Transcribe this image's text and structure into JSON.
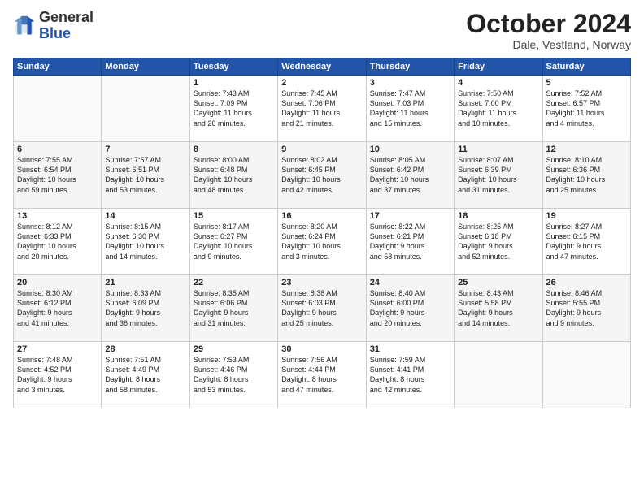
{
  "header": {
    "logo_general": "General",
    "logo_blue": "Blue",
    "month": "October 2024",
    "location": "Dale, Vestland, Norway"
  },
  "weekdays": [
    "Sunday",
    "Monday",
    "Tuesday",
    "Wednesday",
    "Thursday",
    "Friday",
    "Saturday"
  ],
  "weeks": [
    [
      {
        "day": "",
        "info": ""
      },
      {
        "day": "",
        "info": ""
      },
      {
        "day": "1",
        "info": "Sunrise: 7:43 AM\nSunset: 7:09 PM\nDaylight: 11 hours\nand 26 minutes."
      },
      {
        "day": "2",
        "info": "Sunrise: 7:45 AM\nSunset: 7:06 PM\nDaylight: 11 hours\nand 21 minutes."
      },
      {
        "day": "3",
        "info": "Sunrise: 7:47 AM\nSunset: 7:03 PM\nDaylight: 11 hours\nand 15 minutes."
      },
      {
        "day": "4",
        "info": "Sunrise: 7:50 AM\nSunset: 7:00 PM\nDaylight: 11 hours\nand 10 minutes."
      },
      {
        "day": "5",
        "info": "Sunrise: 7:52 AM\nSunset: 6:57 PM\nDaylight: 11 hours\nand 4 minutes."
      }
    ],
    [
      {
        "day": "6",
        "info": "Sunrise: 7:55 AM\nSunset: 6:54 PM\nDaylight: 10 hours\nand 59 minutes."
      },
      {
        "day": "7",
        "info": "Sunrise: 7:57 AM\nSunset: 6:51 PM\nDaylight: 10 hours\nand 53 minutes."
      },
      {
        "day": "8",
        "info": "Sunrise: 8:00 AM\nSunset: 6:48 PM\nDaylight: 10 hours\nand 48 minutes."
      },
      {
        "day": "9",
        "info": "Sunrise: 8:02 AM\nSunset: 6:45 PM\nDaylight: 10 hours\nand 42 minutes."
      },
      {
        "day": "10",
        "info": "Sunrise: 8:05 AM\nSunset: 6:42 PM\nDaylight: 10 hours\nand 37 minutes."
      },
      {
        "day": "11",
        "info": "Sunrise: 8:07 AM\nSunset: 6:39 PM\nDaylight: 10 hours\nand 31 minutes."
      },
      {
        "day": "12",
        "info": "Sunrise: 8:10 AM\nSunset: 6:36 PM\nDaylight: 10 hours\nand 25 minutes."
      }
    ],
    [
      {
        "day": "13",
        "info": "Sunrise: 8:12 AM\nSunset: 6:33 PM\nDaylight: 10 hours\nand 20 minutes."
      },
      {
        "day": "14",
        "info": "Sunrise: 8:15 AM\nSunset: 6:30 PM\nDaylight: 10 hours\nand 14 minutes."
      },
      {
        "day": "15",
        "info": "Sunrise: 8:17 AM\nSunset: 6:27 PM\nDaylight: 10 hours\nand 9 minutes."
      },
      {
        "day": "16",
        "info": "Sunrise: 8:20 AM\nSunset: 6:24 PM\nDaylight: 10 hours\nand 3 minutes."
      },
      {
        "day": "17",
        "info": "Sunrise: 8:22 AM\nSunset: 6:21 PM\nDaylight: 9 hours\nand 58 minutes."
      },
      {
        "day": "18",
        "info": "Sunrise: 8:25 AM\nSunset: 6:18 PM\nDaylight: 9 hours\nand 52 minutes."
      },
      {
        "day": "19",
        "info": "Sunrise: 8:27 AM\nSunset: 6:15 PM\nDaylight: 9 hours\nand 47 minutes."
      }
    ],
    [
      {
        "day": "20",
        "info": "Sunrise: 8:30 AM\nSunset: 6:12 PM\nDaylight: 9 hours\nand 41 minutes."
      },
      {
        "day": "21",
        "info": "Sunrise: 8:33 AM\nSunset: 6:09 PM\nDaylight: 9 hours\nand 36 minutes."
      },
      {
        "day": "22",
        "info": "Sunrise: 8:35 AM\nSunset: 6:06 PM\nDaylight: 9 hours\nand 31 minutes."
      },
      {
        "day": "23",
        "info": "Sunrise: 8:38 AM\nSunset: 6:03 PM\nDaylight: 9 hours\nand 25 minutes."
      },
      {
        "day": "24",
        "info": "Sunrise: 8:40 AM\nSunset: 6:00 PM\nDaylight: 9 hours\nand 20 minutes."
      },
      {
        "day": "25",
        "info": "Sunrise: 8:43 AM\nSunset: 5:58 PM\nDaylight: 9 hours\nand 14 minutes."
      },
      {
        "day": "26",
        "info": "Sunrise: 8:46 AM\nSunset: 5:55 PM\nDaylight: 9 hours\nand 9 minutes."
      }
    ],
    [
      {
        "day": "27",
        "info": "Sunrise: 7:48 AM\nSunset: 4:52 PM\nDaylight: 9 hours\nand 3 minutes."
      },
      {
        "day": "28",
        "info": "Sunrise: 7:51 AM\nSunset: 4:49 PM\nDaylight: 8 hours\nand 58 minutes."
      },
      {
        "day": "29",
        "info": "Sunrise: 7:53 AM\nSunset: 4:46 PM\nDaylight: 8 hours\nand 53 minutes."
      },
      {
        "day": "30",
        "info": "Sunrise: 7:56 AM\nSunset: 4:44 PM\nDaylight: 8 hours\nand 47 minutes."
      },
      {
        "day": "31",
        "info": "Sunrise: 7:59 AM\nSunset: 4:41 PM\nDaylight: 8 hours\nand 42 minutes."
      },
      {
        "day": "",
        "info": ""
      },
      {
        "day": "",
        "info": ""
      }
    ]
  ]
}
